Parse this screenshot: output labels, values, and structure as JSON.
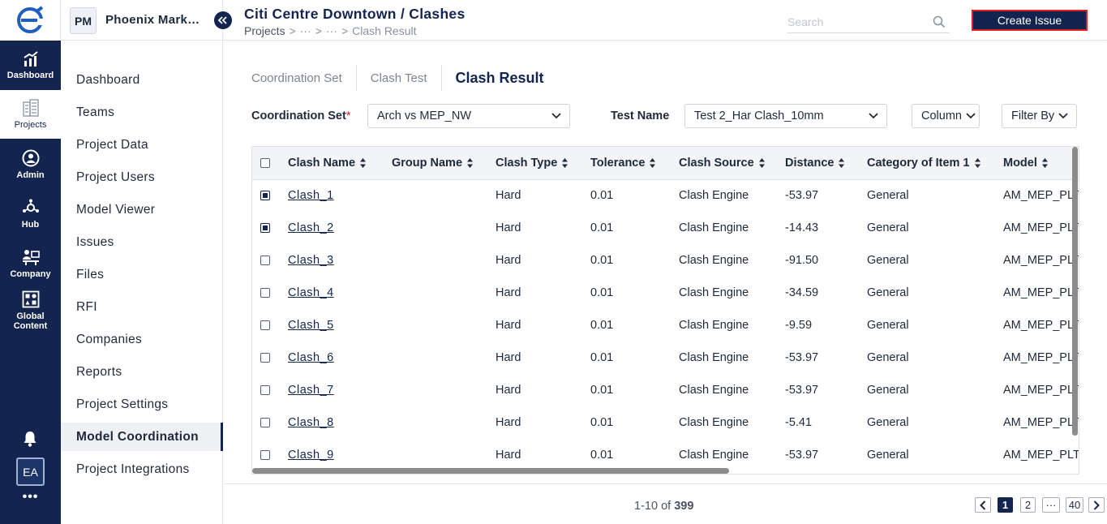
{
  "rail": {
    "items": [
      {
        "label": "Dashboard",
        "icon": "dashboard-icon"
      },
      {
        "label": "Projects",
        "icon": "building-icon"
      },
      {
        "label": "Admin",
        "icon": "admin-icon"
      },
      {
        "label": "Hub",
        "icon": "hub-icon"
      },
      {
        "label": "Company",
        "icon": "company-icon"
      },
      {
        "label": "Global\nContent",
        "icon": "global-content-icon"
      }
    ],
    "avatar": "EA",
    "more": "•••"
  },
  "project": {
    "badge": "PM",
    "name": "Phoenix Mark…"
  },
  "sidebar": {
    "items": [
      {
        "label": "Dashboard"
      },
      {
        "label": "Teams"
      },
      {
        "label": "Project Data"
      },
      {
        "label": "Project Users"
      },
      {
        "label": "Model Viewer"
      },
      {
        "label": "Issues"
      },
      {
        "label": "Files"
      },
      {
        "label": "RFI"
      },
      {
        "label": "Companies"
      },
      {
        "label": "Reports"
      },
      {
        "label": "Project Settings"
      },
      {
        "label": "Model Coordination"
      },
      {
        "label": "Project Integrations"
      }
    ],
    "active_index": 11
  },
  "header": {
    "title": "Citi Centre Downtown / Clashes",
    "breadcrumb": {
      "root": "Projects",
      "sep": ">",
      "ellipsis": "···",
      "current": "Clash Result"
    },
    "search_placeholder": "Search",
    "create_button": "Create Issue"
  },
  "tabs": [
    {
      "label": "Coordination Set",
      "active": false
    },
    {
      "label": "Clash Test",
      "active": false
    },
    {
      "label": "Clash Result",
      "active": true
    }
  ],
  "filters": {
    "coordination_set_label": "Coordination Set",
    "required_mark": "*",
    "coordination_set_value": "Arch vs MEP_NW",
    "test_name_label": "Test Name",
    "test_name_value": "Test 2_Har Clash_10mm",
    "columns_label": "Column",
    "filter_by_label": "Filter By"
  },
  "table": {
    "columns": [
      "Clash Name",
      "Group Name",
      "Clash Type",
      "Tolerance",
      "Clash Source",
      "Distance",
      "Category of Item 1",
      "Model"
    ],
    "rows": [
      {
        "checked": true,
        "name": "Clash_1",
        "group": "",
        "type": "Hard",
        "tolerance": "0.01",
        "source": "Clash Engine",
        "distance": "-53.97",
        "category": "General",
        "model": "AM_MEP_PLT_"
      },
      {
        "checked": true,
        "name": "Clash_2",
        "group": "",
        "type": "Hard",
        "tolerance": "0.01",
        "source": "Clash Engine",
        "distance": "-14.43",
        "category": "General",
        "model": "AM_MEP_PLT_"
      },
      {
        "checked": false,
        "name": "Clash_3",
        "group": "",
        "type": "Hard",
        "tolerance": "0.01",
        "source": "Clash Engine",
        "distance": "-91.50",
        "category": "General",
        "model": "AM_MEP_PLT_"
      },
      {
        "checked": false,
        "name": "Clash_4",
        "group": "",
        "type": "Hard",
        "tolerance": "0.01",
        "source": "Clash Engine",
        "distance": "-34.59",
        "category": "General",
        "model": "AM_MEP_PLT_"
      },
      {
        "checked": false,
        "name": "Clash_5",
        "group": "",
        "type": "Hard",
        "tolerance": "0.01",
        "source": "Clash Engine",
        "distance": "-9.59",
        "category": "General",
        "model": "AM_MEP_PLT_"
      },
      {
        "checked": false,
        "name": "Clash_6",
        "group": "",
        "type": "Hard",
        "tolerance": "0.01",
        "source": "Clash Engine",
        "distance": "-53.97",
        "category": "General",
        "model": "AM_MEP_PLT_"
      },
      {
        "checked": false,
        "name": "Clash_7",
        "group": "",
        "type": "Hard",
        "tolerance": "0.01",
        "source": "Clash Engine",
        "distance": "-53.97",
        "category": "General",
        "model": "AM_MEP_PLT_"
      },
      {
        "checked": false,
        "name": "Clash_8",
        "group": "",
        "type": "Hard",
        "tolerance": "0.01",
        "source": "Clash Engine",
        "distance": "-5.41",
        "category": "General",
        "model": "AM_MEP_PLT_"
      },
      {
        "checked": false,
        "name": "Clash_9",
        "group": "",
        "type": "Hard",
        "tolerance": "0.01",
        "source": "Clash Engine",
        "distance": "-53.97",
        "category": "General",
        "model": "AM_MEP_PLT_"
      }
    ]
  },
  "pagination": {
    "range": "1-10",
    "of": "of",
    "total": "399",
    "pages": [
      "1",
      "2",
      "···",
      "40"
    ],
    "current": "1"
  },
  "colors": {
    "primary": "#13254f",
    "accent_border": "#e02020",
    "required": "#e02020"
  }
}
